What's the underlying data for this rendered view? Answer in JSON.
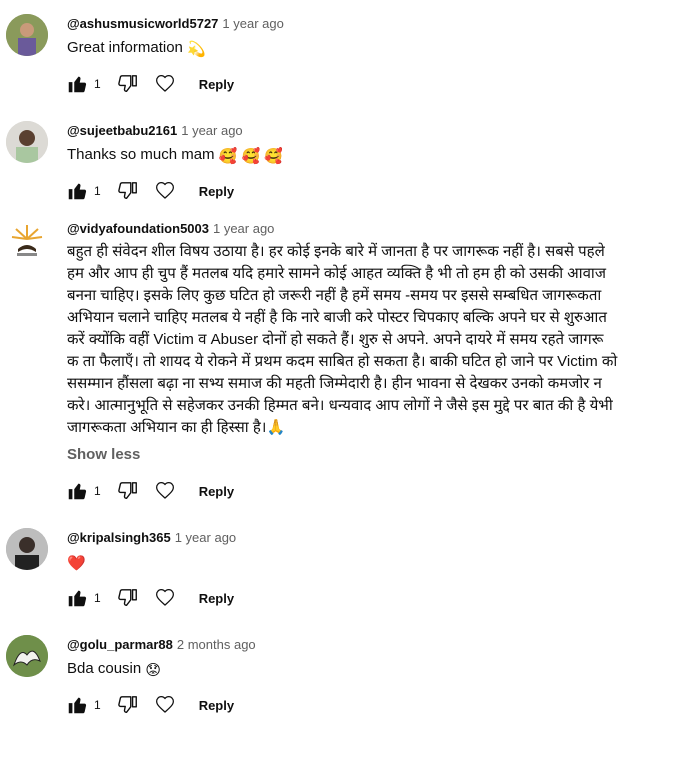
{
  "comments": [
    {
      "author": "@ashusmusicworld5727",
      "time": "1 year ago",
      "text": "Great information",
      "emoji": "💫",
      "likes": "1",
      "reply": "Reply",
      "avatar_color": "#6b7a3e"
    },
    {
      "author": "@sujeetbabu2161",
      "time": "1 year ago",
      "text": "Thanks so much mam",
      "emoji": "🥰 🥰 🥰",
      "likes": "1",
      "reply": "Reply",
      "avatar_color": "#c9c6c0"
    },
    {
      "author": "@vidyafoundation5003",
      "time": "1 year ago",
      "text_lines": [
        "बहुत ही संवेदन शील विषय उठाया है। हर कोई इनके बारे में जानता है पर जागरूक नहीं है। सबसे पहले",
        "हम और आप ही चुप हैं मतलब यदि हमारे सामने कोई आहत व्यक्ति है भी तो हम ही को उसकी आवाज",
        "बनना चाहिए। इसके लिए कुछ घटित हो जरूरी नहीं है हमें समय -समय पर इससे सम्बधित जागरूकता",
        "अभियान चलाने चाहिए मतलब ये नहीं है कि नारे बाजी करे पोस्टर चिपकाए बल्कि अपने घर से शुरुआत",
        "करें क्योंकि वहीं Victim व Abuser दोनों हो सकते हैं। शुरु से अपने. अपने दायरे में समय रहते जागरू",
        "क ता फैलाएँ। तो शायद ये रोकने में प्रथम कदम साबित हो सकता है। बाकी घटित हो जाने पर Victim को",
        "ससम्मान हौंसला बढ़ा ना सभ्य समाज की महती जिम्मेदारी है। हीन भावना से देखकर उनको कमजोर न",
        "करे। आत्मानुभूति से सहेजकर उनकी हिम्मत बने। धन्यवाद आप लोगों ने जैसे इस मुद्दे पर बात की है येभी",
        "जागरूकता अभियान का ही हिस्सा है।🙏"
      ],
      "show_less": "Show less",
      "likes": "1",
      "reply": "Reply",
      "avatar_color": "#f3d27a"
    },
    {
      "author": "@kripalsingh365",
      "time": "1 year ago",
      "text": "",
      "emoji": "❤️",
      "likes": "1",
      "reply": "Reply",
      "avatar_color": "#9a9a9a"
    },
    {
      "author": "@golu_parmar88",
      "time": "2 months ago",
      "text": "Bda cousin",
      "emoji": "😟",
      "likes": "1",
      "reply": "Reply",
      "avatar_color": "#5a7a3a"
    }
  ],
  "icons": {
    "like": "thumbs-up-filled",
    "dislike": "thumbs-down-outline",
    "heart": "heart-outline"
  }
}
